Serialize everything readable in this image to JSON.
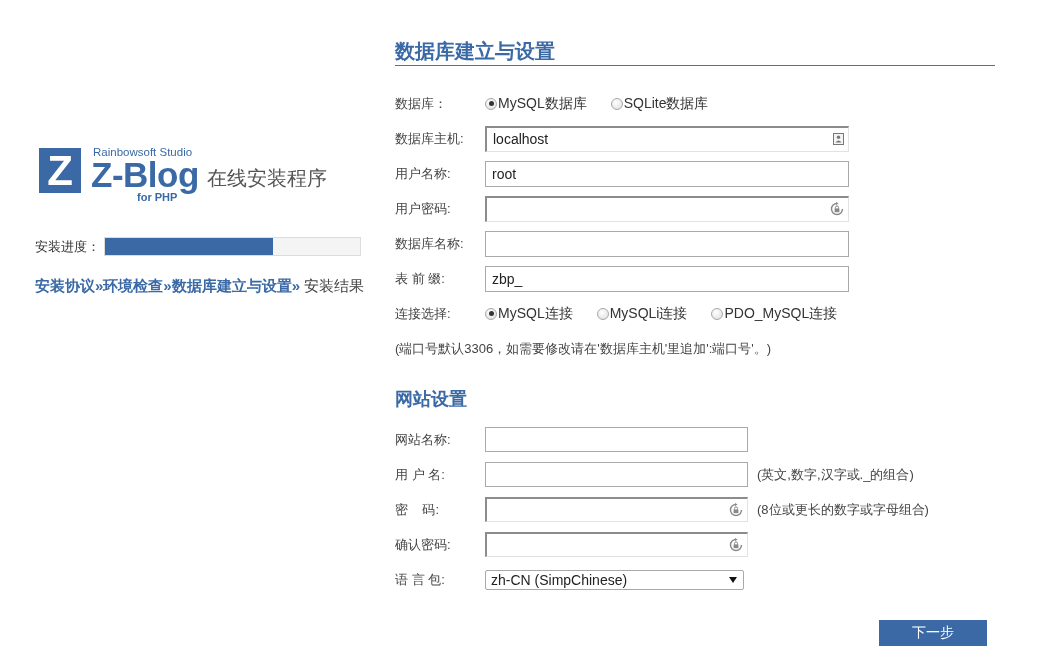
{
  "logo": {
    "mark": "Z",
    "studio": "Rainbowsoft Studio",
    "name": "Z-Blog",
    "platform": "for PHP",
    "subtitle": "在线安装程序"
  },
  "progress": {
    "label": "安装进度：",
    "level": 0.66
  },
  "steps": [
    {
      "label": "安装协议",
      "separator": "»",
      "done": true
    },
    {
      "label": "环境检查",
      "separator": "»",
      "done": true
    },
    {
      "label": "数据库建立与设置",
      "separator": "»",
      "done": true
    },
    {
      "label": "安装结果",
      "done": false
    }
  ],
  "database_section": {
    "title": "数据库建立与设置",
    "rows": [
      {
        "kind": "radio",
        "label": "数据库：",
        "options": [
          {
            "label": "MySQL数据库",
            "selected": true
          },
          {
            "label": "SQLite数据库",
            "selected": false
          }
        ]
      },
      {
        "kind": "contact_input",
        "label": "数据库主机:",
        "value": "localhost"
      },
      {
        "kind": "text_input",
        "label": "用户名称:",
        "value": "root"
      },
      {
        "kind": "password_input",
        "label": "用户密码:"
      },
      {
        "kind": "text_input",
        "label": "数据库名称:"
      },
      {
        "kind": "text_input",
        "label": "表 前 缀:",
        "value": "zbp_"
      },
      {
        "kind": "radio",
        "label": "连接选择:",
        "options": [
          {
            "label": "MySQL连接",
            "selected": true
          },
          {
            "label": "MySQLi连接",
            "selected": false
          },
          {
            "label": "PDO_MySQL连接",
            "selected": false
          }
        ]
      },
      {
        "kind": "note",
        "text": "(端口号默认3306，如需要修改请在'数据库主机'里追加':端口号'。)"
      }
    ]
  },
  "site_section": {
    "title": "网站设置",
    "rows": [
      {
        "kind": "text_input",
        "label": "网站名称:"
      },
      {
        "kind": "text_input",
        "label": "用 户 名:",
        "hint": "(英文,数字,汉字或._的组合)"
      },
      {
        "kind": "password_input",
        "label": "密    码:",
        "hint": "(8位或更长的数字或字母组合)"
      },
      {
        "kind": "password_input",
        "label": "确认密码:"
      },
      {
        "kind": "select",
        "label": "语 言 包:",
        "value": "zh-CN (SimpChinese)"
      }
    ]
  },
  "next_button": "下一步"
}
